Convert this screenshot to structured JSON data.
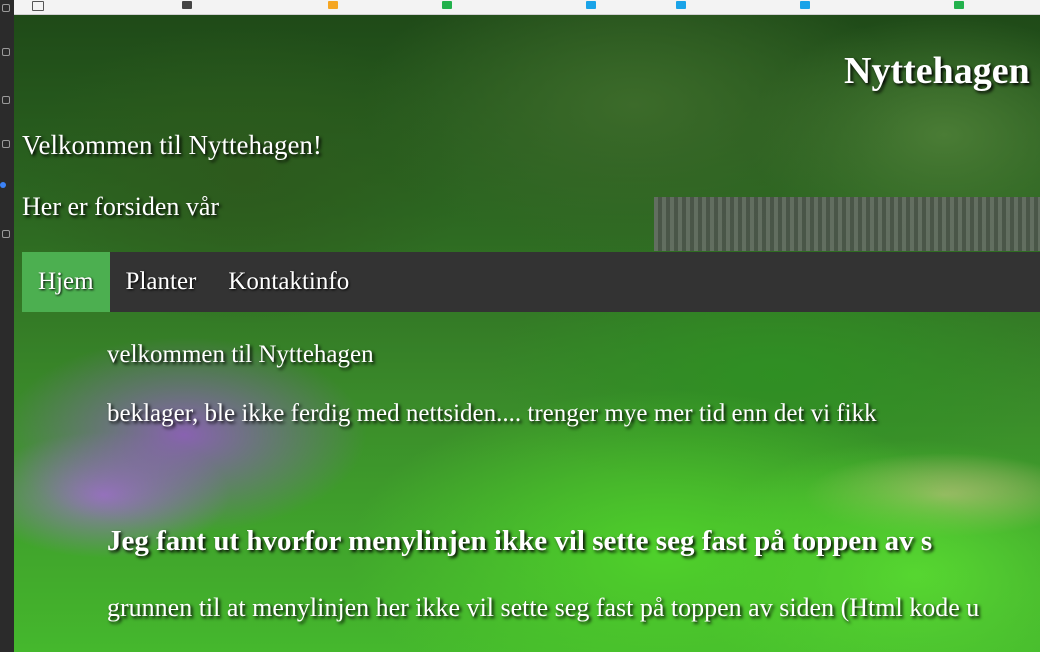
{
  "header": {
    "site_title": "Nyttehagen",
    "welcome": "Velkommen til Nyttehagen!",
    "subtitle": "Her er forsiden vår"
  },
  "nav": {
    "items": [
      {
        "label": "Hjem",
        "active": true
      },
      {
        "label": "Planter",
        "active": false
      },
      {
        "label": "Kontaktinfo",
        "active": false
      }
    ]
  },
  "content": {
    "line1": "velkommen til Nyttehagen",
    "line2": "beklager, ble ikke ferdig med nettsiden.... trenger mye mer tid enn det vi fikk",
    "heading": "Jeg fant ut hvorfor menylinjen ikke vil sette seg fast på toppen av s",
    "line3": "grunnen til at menylinjen her ikke vil sette seg fast på toppen av siden (Html kode u"
  },
  "colors": {
    "nav_background": "#333333",
    "nav_active": "#4caf50",
    "text": "#ffffff"
  }
}
